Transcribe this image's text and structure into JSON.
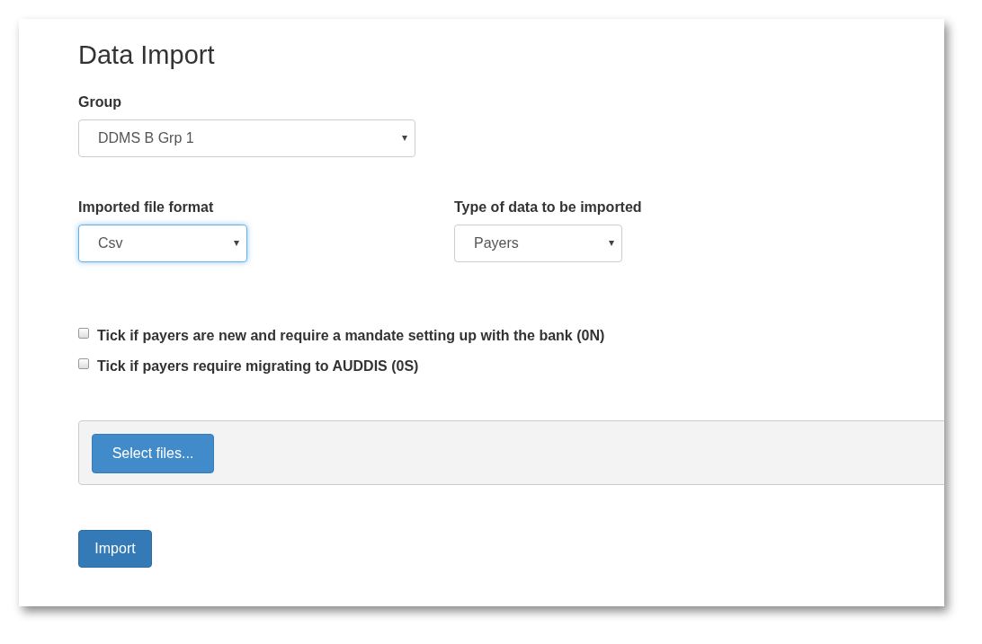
{
  "title": "Data Import",
  "group": {
    "label": "Group",
    "value": "DDMS B Grp 1",
    "focused": false
  },
  "selects": [
    {
      "label": "Imported file format",
      "value": "Csv",
      "focused": true
    },
    {
      "label": "Type of data to be imported",
      "value": "Payers",
      "focused": false
    }
  ],
  "checkboxes": [
    {
      "label": "Tick if payers are new and require a mandate setting up with the bank (0N)",
      "checked": false
    },
    {
      "label": "Tick if payers require migrating to AUDDIS (0S)",
      "checked": false
    }
  ],
  "upload": {
    "button": "Select files..."
  },
  "submit": "Import"
}
